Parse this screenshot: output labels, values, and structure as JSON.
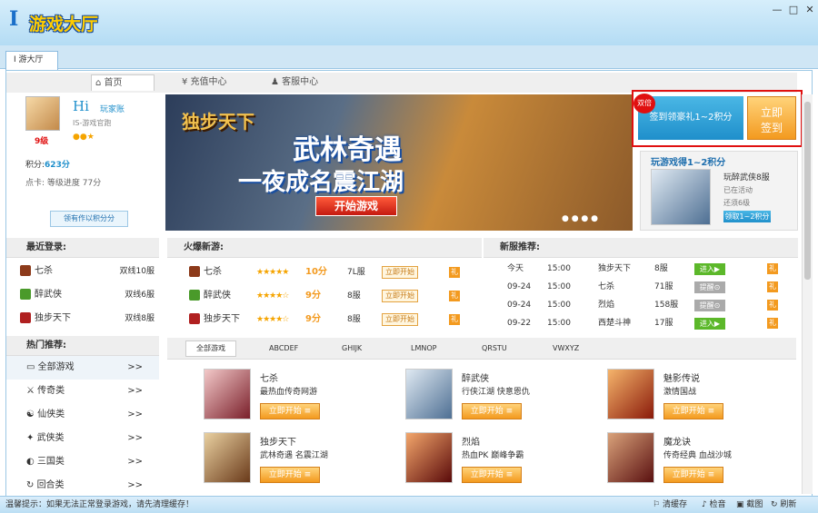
{
  "app": {
    "logo_prefix": "I",
    "logo_text": "游戏大厅",
    "tab_label": "I 游大厅",
    "window_buttons": [
      "—",
      "□",
      "✕"
    ]
  },
  "nav": {
    "tabs": [
      "首页",
      "充值中心",
      "客服中心"
    ]
  },
  "profile": {
    "greeting": "Hi",
    "username": "玩家账",
    "subtitle": "IS-游戏官跑",
    "level": "9级",
    "points_label": "积分:",
    "points_value": "623分",
    "duration_label": "点卡:",
    "duration_value": "等级进度 77分",
    "button": "领有作以积分分"
  },
  "recent": {
    "title": "最近登录:",
    "items": [
      {
        "name": "七杀",
        "server": "双线10服"
      },
      {
        "name": "醉武侠",
        "server": "双线6服"
      },
      {
        "name": "独步天下",
        "server": "双线8服"
      }
    ]
  },
  "hot": {
    "title": "热门推荐:",
    "items": [
      "全部游戏",
      "传奇类",
      "仙侠类",
      "武侠类",
      "三国类",
      "回合类"
    ],
    "arrow": ">>"
  },
  "banner": {
    "logo": "独步天下",
    "line1": "武林奇遇",
    "line2": "一夜成名震江湖",
    "cta": "开始游戏"
  },
  "signin": {
    "badge": "双倍",
    "text": "签到领豪礼1~2积分",
    "button_line1": "立即",
    "button_line2": "签到"
  },
  "promo": {
    "title": "玩游戏得1~2积分",
    "game": "玩醉武侠8服",
    "line1": "已在活动",
    "line2": "还须6级",
    "button": "领取1~2积分"
  },
  "fire": {
    "title": "火爆新游:",
    "rows": [
      {
        "name": "七杀",
        "stars": "★★★★★",
        "score": "10分",
        "server": "7L服",
        "button": "立即开始",
        "gift": "礼"
      },
      {
        "name": "醉武侠",
        "stars": "★★★★☆",
        "score": "9分",
        "server": "8服",
        "button": "立即开始",
        "gift": "礼"
      },
      {
        "name": "独步天下",
        "stars": "★★★★☆",
        "score": "9分",
        "server": "8服",
        "button": "立即开始",
        "gift": "礼"
      }
    ]
  },
  "servers": {
    "title": "新服推荐:",
    "rows": [
      {
        "date": "今天",
        "time": "15:00",
        "game": "独步天下",
        "server": "8服",
        "status": "进入▶",
        "gift": "礼"
      },
      {
        "date": "09-24",
        "time": "15:00",
        "game": "七杀",
        "server": "71服",
        "status": "提醒⊙",
        "gift": "礼"
      },
      {
        "date": "09-24",
        "time": "15:00",
        "game": "烈焰",
        "server": "158服",
        "status": "提醒⊙",
        "gift": "礼"
      },
      {
        "date": "09-22",
        "time": "15:00",
        "game": "西楚斗神",
        "server": "17服",
        "status": "进入▶",
        "gift": "礼"
      }
    ]
  },
  "gametabs": [
    "全部游戏",
    "ABCDEF",
    "GHIJK",
    "LMNOP",
    "QRSTU",
    "VWXYZ"
  ],
  "cards": [
    {
      "name": "七杀",
      "desc": "最热血传奇网游",
      "button": "立即开始"
    },
    {
      "name": "醉武侠",
      "desc": "行侠江湖 快意恩仇",
      "button": "立即开始"
    },
    {
      "name": "魅影传说",
      "desc": "激情国战",
      "button": "立即开始"
    },
    {
      "name": "独步天下",
      "desc": "武林奇遇 名震江湖",
      "button": "立即开始"
    },
    {
      "name": "烈焰",
      "desc": "热血PK 巅峰争霸",
      "button": "立即开始"
    },
    {
      "name": "魔龙诀",
      "desc": "传奇经典 血战沙城",
      "button": "立即开始"
    }
  ],
  "status": {
    "tip": "温馨提示：如果无法正常登录游戏，请先清理缓存！",
    "items": [
      "清缓存",
      "检音",
      "截图",
      "刷新"
    ]
  },
  "colors": {
    "accent": "#1f8fcb",
    "orange": "#f39a1f",
    "red": "#e01010"
  }
}
